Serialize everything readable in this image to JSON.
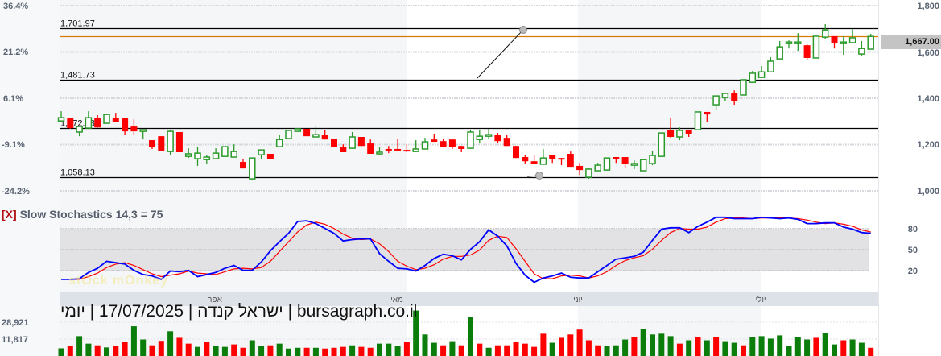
{
  "chart_data": {
    "type": "candlestick",
    "title": "",
    "price_axis": {
      "ticks": [
        "1,800",
        "1,600",
        "1,400",
        "1,200",
        "1,000"
      ],
      "ylim": [
        1000,
        1800
      ]
    },
    "percent_axis": {
      "ticks": [
        "36.4%",
        "21.2%",
        "6.1%",
        "-9.1%",
        "-24.2%"
      ]
    },
    "months": [
      "אפר",
      "מאי",
      "יוני",
      "יולי"
    ],
    "levels": [
      {
        "label": "1,701.97",
        "value": 1701.97
      },
      {
        "label": "1,481.73",
        "value": 1481.73
      },
      {
        "label": "1,272.38",
        "value": 1272.38
      },
      {
        "label": "1,058.13",
        "value": 1058.13
      }
    ],
    "last_price": {
      "label": "1,667.00",
      "value": 1667.0
    },
    "ohlc": [
      [
        1302,
        1344,
        1302,
        1316
      ],
      [
        1313,
        1313,
        1268,
        1271
      ],
      [
        1254,
        1278,
        1236,
        1278
      ],
      [
        1271,
        1344,
        1271,
        1316
      ],
      [
        1316,
        1327,
        1274,
        1274
      ],
      [
        1292,
        1334,
        1292,
        1330
      ],
      [
        1313,
        1337,
        1299,
        1299
      ],
      [
        1313,
        1313,
        1243,
        1257
      ],
      [
        1278,
        1309,
        1240,
        1257
      ],
      [
        1261,
        1264,
        1222,
        1264
      ],
      [
        1219,
        1219,
        1181,
        1191
      ],
      [
        1236,
        1236,
        1174,
        1174
      ],
      [
        1170,
        1264,
        1156,
        1257
      ],
      [
        1254,
        1254,
        1167,
        1167
      ],
      [
        1149,
        1184,
        1142,
        1160
      ],
      [
        1139,
        1188,
        1108,
        1163
      ],
      [
        1135,
        1156,
        1115,
        1146
      ],
      [
        1139,
        1184,
        1139,
        1163
      ],
      [
        1149,
        1191,
        1149,
        1191
      ],
      [
        1146,
        1201,
        1146,
        1170
      ],
      [
        1125,
        1139,
        1097,
        1097
      ],
      [
        1052,
        1142,
        1045,
        1142
      ],
      [
        1156,
        1177,
        1139,
        1177
      ],
      [
        1160,
        1160,
        1139,
        1139
      ],
      [
        1191,
        1243,
        1191,
        1222
      ],
      [
        1226,
        1261,
        1226,
        1261
      ],
      [
        1257,
        1268,
        1257,
        1268
      ],
      [
        1268,
        1268,
        1236,
        1236
      ],
      [
        1233,
        1278,
        1233,
        1243
      ],
      [
        1240,
        1264,
        1222,
        1222
      ],
      [
        1226,
        1226,
        1188,
        1188
      ],
      [
        1188,
        1201,
        1167,
        1167
      ],
      [
        1184,
        1254,
        1184,
        1233
      ],
      [
        1233,
        1233,
        1194,
        1194
      ],
      [
        1205,
        1222,
        1160,
        1160
      ],
      [
        1160,
        1191,
        1153,
        1167
      ],
      [
        1181,
        1194,
        1163,
        1174
      ],
      [
        1181,
        1226,
        1177,
        1177
      ],
      [
        1177,
        1201,
        1167,
        1174
      ],
      [
        1170,
        1219,
        1170,
        1181
      ],
      [
        1181,
        1229,
        1181,
        1212
      ],
      [
        1222,
        1247,
        1212,
        1212
      ],
      [
        1215,
        1226,
        1191,
        1191
      ],
      [
        1222,
        1222,
        1181,
        1191
      ],
      [
        1194,
        1194,
        1167,
        1181
      ],
      [
        1184,
        1261,
        1184,
        1254
      ],
      [
        1222,
        1261,
        1205,
        1236
      ],
      [
        1240,
        1268,
        1226,
        1243
      ],
      [
        1243,
        1250,
        1205,
        1215
      ],
      [
        1229,
        1240,
        1194,
        1194
      ],
      [
        1194,
        1194,
        1142,
        1142
      ],
      [
        1146,
        1156,
        1115,
        1128
      ],
      [
        1128,
        1156,
        1115,
        1115
      ],
      [
        1115,
        1181,
        1115,
        1142
      ],
      [
        1153,
        1153,
        1121,
        1139
      ],
      [
        1142,
        1142,
        1111,
        1139
      ],
      [
        1160,
        1170,
        1104,
        1104
      ],
      [
        1108,
        1121,
        1069,
        1090
      ],
      [
        1059,
        1101,
        1052,
        1094
      ],
      [
        1087,
        1121,
        1087,
        1111
      ],
      [
        1090,
        1142,
        1090,
        1142
      ],
      [
        1146,
        1146,
        1121,
        1139
      ],
      [
        1146,
        1146,
        1097,
        1115
      ],
      [
        1111,
        1132,
        1094,
        1118
      ],
      [
        1087,
        1135,
        1087,
        1135
      ],
      [
        1118,
        1174,
        1111,
        1153
      ],
      [
        1149,
        1250,
        1149,
        1250
      ],
      [
        1261,
        1313,
        1229,
        1233
      ],
      [
        1233,
        1274,
        1219,
        1261
      ],
      [
        1261,
        1264,
        1233,
        1247
      ],
      [
        1264,
        1341,
        1264,
        1341
      ],
      [
        1341,
        1341,
        1299,
        1330
      ],
      [
        1372,
        1410,
        1348,
        1410
      ],
      [
        1403,
        1421,
        1386,
        1421
      ],
      [
        1421,
        1434,
        1372,
        1389
      ],
      [
        1414,
        1480,
        1414,
        1480
      ],
      [
        1469,
        1518,
        1466,
        1508
      ],
      [
        1490,
        1539,
        1490,
        1514
      ],
      [
        1514,
        1577,
        1511,
        1560
      ],
      [
        1570,
        1647,
        1570,
        1622
      ],
      [
        1636,
        1650,
        1615,
        1643
      ],
      [
        1636,
        1681,
        1605,
        1643
      ],
      [
        1629,
        1633,
        1567,
        1574
      ],
      [
        1574,
        1668,
        1574,
        1668
      ],
      [
        1664,
        1720,
        1657,
        1695
      ],
      [
        1668,
        1668,
        1615,
        1640
      ],
      [
        1640,
        1668,
        1588,
        1643
      ],
      [
        1640,
        1699,
        1636,
        1661
      ],
      [
        1591,
        1647,
        1581,
        1615
      ],
      [
        1612,
        1678,
        1612,
        1667
      ]
    ],
    "stochastic": {
      "title": "Slow Stochastics 14,3 = 75",
      "close_label": "[X]",
      "ticks": [
        "80",
        "50",
        "20"
      ],
      "ylim": [
        0,
        100
      ],
      "band": [
        20,
        80
      ],
      "k": [
        7,
        7,
        8,
        17,
        23,
        33,
        31,
        29,
        20,
        14,
        12,
        7,
        19,
        18,
        20,
        11,
        14,
        17,
        23,
        27,
        20,
        20,
        32,
        48,
        61,
        73,
        90,
        91,
        87,
        80,
        73,
        62,
        64,
        65,
        65,
        44,
        33,
        23,
        22,
        19,
        27,
        37,
        43,
        41,
        35,
        50,
        61,
        78,
        69,
        55,
        30,
        13,
        3,
        9,
        12,
        16,
        10,
        9,
        9,
        18,
        27,
        36,
        38,
        40,
        46,
        63,
        79,
        81,
        81,
        74,
        83,
        89,
        96,
        96,
        94,
        94,
        94,
        96,
        95,
        94,
        95,
        93,
        87,
        87,
        88,
        88,
        82,
        79,
        74,
        73
      ],
      "d": [
        7,
        7,
        7,
        11,
        16,
        24,
        29,
        31,
        27,
        21,
        15,
        11,
        13,
        15,
        19,
        16,
        15,
        14,
        18,
        22,
        23,
        22,
        24,
        33,
        47,
        61,
        75,
        85,
        89,
        86,
        80,
        72,
        66,
        64,
        65,
        58,
        47,
        33,
        26,
        21,
        23,
        28,
        36,
        40,
        40,
        42,
        49,
        63,
        69,
        67,
        51,
        33,
        15,
        8,
        8,
        12,
        13,
        12,
        9,
        12,
        18,
        27,
        34,
        38,
        41,
        50,
        63,
        74,
        80,
        79,
        79,
        82,
        89,
        94,
        95,
        95,
        94,
        95,
        95,
        95,
        95,
        94,
        92,
        89,
        87,
        88,
        86,
        83,
        78,
        75
      ],
      "colors": {
        "k": "#0000ff",
        "d": "#ff0000"
      }
    },
    "volume": {
      "ticks": [
        "28,921",
        "11,817"
      ],
      "values": [
        6900,
        8900,
        17800,
        11100,
        9600,
        7700,
        8900,
        12800,
        26700,
        14800,
        9600,
        13600,
        22200,
        16300,
        11100,
        8200,
        12600,
        8900,
        8200,
        10400,
        7400,
        14100,
        8900,
        9600,
        11100,
        6700,
        7400,
        7400,
        7400,
        6700,
        7400,
        8200,
        9600,
        8200,
        7400,
        11100,
        11100,
        8900,
        12600,
        40800,
        19300,
        11900,
        9600,
        13300,
        9600,
        34800,
        11100,
        7400,
        9600,
        9600,
        12600,
        11100,
        8200,
        20000,
        11900,
        16300,
        19300,
        23700,
        14100,
        9600,
        8900,
        9600,
        14800,
        17000,
        24500,
        19300,
        20000,
        17800,
        11100,
        14100,
        17000,
        14100,
        17000,
        13300,
        11900,
        9600,
        17000,
        17800,
        15600,
        18500,
        8900,
        17000,
        14800,
        16300,
        20700,
        10400,
        14100,
        14800,
        11900,
        7400
      ],
      "up": "GRGGRGRRGGRRGRRGRGGRRGGRGGGRGRRRGRRGGGRGGGRGRGRGRRRRRRGRRRRRGGGRGGGGRGRGRGGRGGGGGGGRGGRGGRG"
    },
    "colors": {
      "up": "#2a9a2a",
      "down": "#ff0000",
      "level_line": "#000000",
      "last_price_line": "#d97a00",
      "band": "#e2e2e4",
      "time_bar": "#dde1e8"
    }
  },
  "footer": {
    "text": "bursagraph.co.il | ישראל קנדה | 17/07/2025 | יומי"
  },
  "watermark": "stock monkey"
}
